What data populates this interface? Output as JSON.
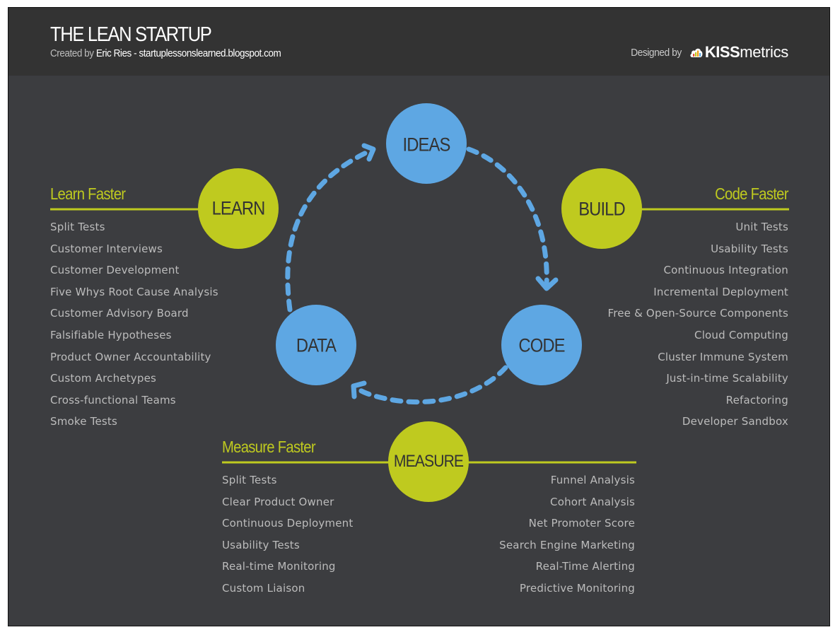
{
  "header": {
    "title": "THE LEAN STARTUP",
    "subtitle_prefix": "Created by",
    "subtitle_author": "Eric Ries - startuplessonslearned.blogspot.com",
    "designed_by_label": "Designed by",
    "logo_bold": "KISS",
    "logo_regular": "metrics",
    "logo_icon": "cloud-bar-chart-icon"
  },
  "colors": {
    "background": "#3c3d40",
    "header_background": "#333333",
    "accent_green": "#bfca1f",
    "cycle_blue": "#5ea7e3",
    "list_text": "#bcbcbc",
    "circle_text": "#333333"
  },
  "cycle": {
    "nodes": [
      {
        "id": "ideas",
        "label": "IDEAS"
      },
      {
        "id": "code",
        "label": "CODE"
      },
      {
        "id": "data",
        "label": "DATA"
      }
    ],
    "arrows": [
      {
        "from": "ideas",
        "to": "code",
        "style": "dashed"
      },
      {
        "from": "code",
        "to": "data",
        "style": "dashed"
      },
      {
        "from": "data",
        "to": "ideas",
        "style": "dashed"
      }
    ]
  },
  "phases": {
    "learn": {
      "circle_label": "LEARN",
      "title": "Learn Faster",
      "items": [
        "Split Tests",
        "Customer Interviews",
        "Customer Development",
        "Five Whys Root Cause Analysis",
        "Customer Advisory Board",
        "Falsifiable Hypotheses",
        "Product Owner Accountability",
        "Custom Archetypes",
        "Cross-functional Teams",
        "Smoke Tests"
      ]
    },
    "build": {
      "circle_label": "BUILD",
      "title": "Code Faster",
      "items": [
        "Unit Tests",
        "Usability Tests",
        "Continuous Integration",
        "Incremental Deployment",
        "Free & Open-Source Components",
        "Cloud Computing",
        "Cluster Immune System",
        "Just-in-time Scalability",
        "Refactoring",
        "Developer Sandbox"
      ]
    },
    "measure": {
      "circle_label": "MEASURE",
      "title": "Measure Faster",
      "items_left": [
        "Split Tests",
        "Clear Product Owner",
        "Continuous Deployment",
        "Usability Tests",
        "Real-time Monitoring",
        "Custom Liaison"
      ],
      "items_right": [
        "Funnel Analysis",
        "Cohort Analysis",
        "Net Promoter Score",
        "Search Engine Marketing",
        "Real-Time Alerting",
        "Predictive Monitoring"
      ]
    }
  }
}
